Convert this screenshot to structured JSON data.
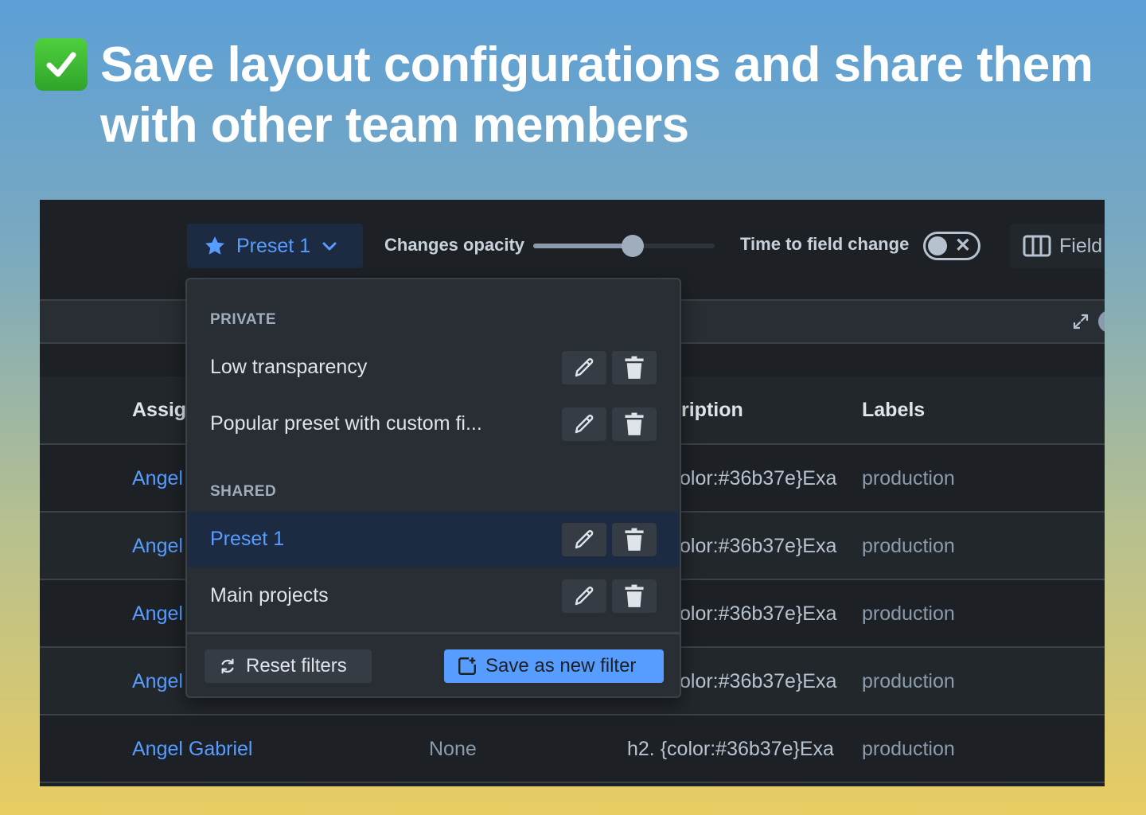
{
  "headline": {
    "line1": "Save layout configurations and share them",
    "line2": "with other team members"
  },
  "toolbar": {
    "preset_label": "Preset 1",
    "opacity_label": "Changes opacity",
    "opacity_value": 0.55,
    "time_label": "Time to field change",
    "toggle_on": false,
    "fields_label": "Field"
  },
  "table": {
    "headers": [
      "Assig",
      "ription",
      "Labels"
    ],
    "rows": [
      {
        "assignee": "Angel",
        "reporter": "",
        "description": "olor:#36b37e}Exa",
        "labels": "production"
      },
      {
        "assignee": "Angel",
        "reporter": "",
        "description": "olor:#36b37e}Exa",
        "labels": "production"
      },
      {
        "assignee": "Angel",
        "reporter": "",
        "description": "olor:#36b37e}Exa",
        "labels": "production"
      },
      {
        "assignee": "Angel",
        "reporter": "",
        "description": "olor:#36b37e}Exa",
        "labels": "production"
      },
      {
        "assignee": "Angel Gabriel",
        "reporter": "None",
        "description": "h2. {color:#36b37e}Exa",
        "labels": "production"
      }
    ]
  },
  "dropdown": {
    "private_title": "PRIVATE",
    "private_items": [
      "Low transparency",
      "Popular preset with custom fi..."
    ],
    "shared_title": "SHARED",
    "shared_items": [
      "Preset 1",
      "Main projects"
    ],
    "active_item": "Preset 1",
    "reset_label": "Reset filters",
    "save_label": "Save as new filter"
  },
  "colors": {
    "accent": "#579dff",
    "background": "#1d2125",
    "check": "#2ea52a"
  },
  "icons": [
    "check-icon",
    "star-icon",
    "chevron-down-icon",
    "columns-icon",
    "expand-icon",
    "pencil-icon",
    "trash-icon",
    "refresh-icon",
    "add-filter-icon"
  ]
}
